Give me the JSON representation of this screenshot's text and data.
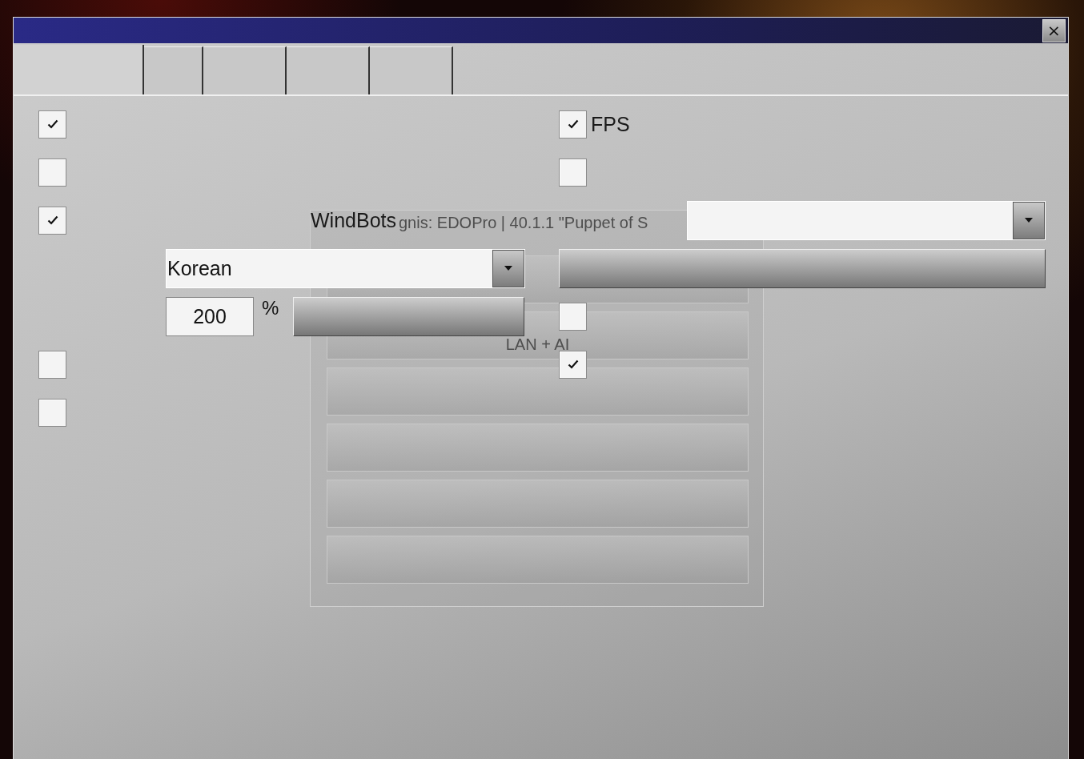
{
  "background_menu": {
    "title": "gnis: EDOPro | 40.1.1 \"Puppet of S",
    "buttons": [
      {
        "kind": "blank"
      },
      {
        "kind": "labeled",
        "label": "LAN + AI"
      },
      {
        "kind": "blank"
      },
      {
        "kind": "blank"
      },
      {
        "kind": "blank"
      },
      {
        "kind": "blank"
      }
    ]
  },
  "window": {
    "close": "×"
  },
  "tabs": [
    {
      "selected": true
    },
    {
      "selected": false
    },
    {
      "selected": false
    },
    {
      "selected": false
    },
    {
      "selected": false
    }
  ],
  "left_column": [
    {
      "kind": "checkbox",
      "checked": true
    },
    {
      "kind": "checkbox",
      "checked": false
    },
    {
      "kind": "checkbox",
      "checked": true,
      "label": "WindBots"
    },
    {
      "kind": "dropdown",
      "value": "Korean"
    },
    {
      "kind": "scale",
      "value": "200",
      "unit": "%"
    },
    {
      "kind": "checkbox",
      "checked": false
    },
    {
      "kind": "checkbox",
      "checked": false
    }
  ],
  "right_column": [
    {
      "kind": "checkbox",
      "checked": true,
      "label": "FPS"
    },
    {
      "kind": "checkbox",
      "checked": false
    },
    {
      "kind": "dropdown"
    },
    {
      "kind": "button"
    },
    {
      "kind": "checkbox",
      "checked": false
    },
    {
      "kind": "checkbox",
      "checked": true
    }
  ]
}
